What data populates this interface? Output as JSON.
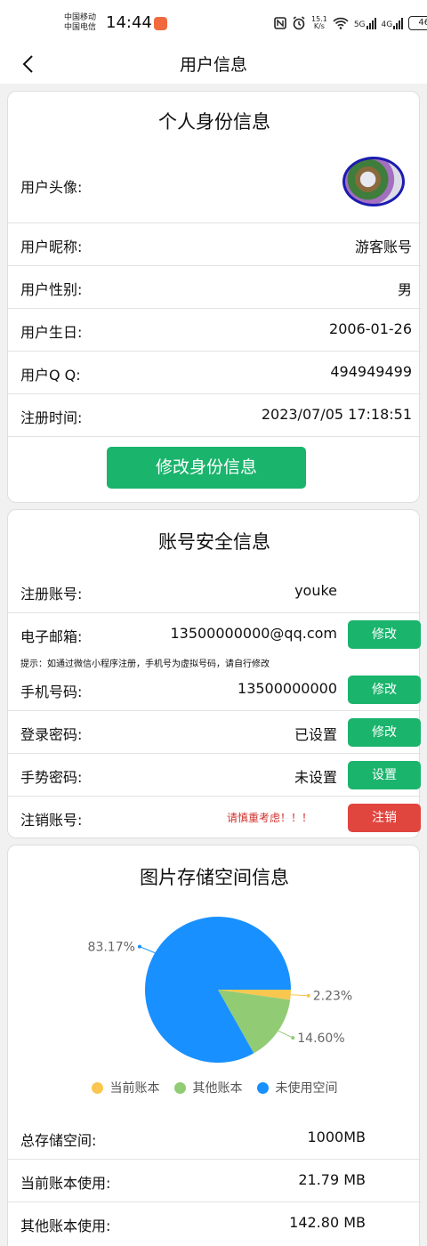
{
  "status_bar": {
    "carrier_1": "中国移动",
    "carrier_2": "中国电信",
    "time": "14:44",
    "net_speed_value": "15.1",
    "net_speed_unit": "K/s",
    "signal_1": "5G",
    "signal_2": "4G",
    "battery": "46"
  },
  "nav": {
    "title": "用户信息"
  },
  "identity": {
    "title": "个人身份信息",
    "avatar_label": "用户头像:",
    "rows": [
      {
        "label": "用户昵称:",
        "value": "游客账号"
      },
      {
        "label": "用户性别:",
        "value": "男"
      },
      {
        "label": "用户生日:",
        "value": "2006-01-26"
      },
      {
        "label": "用户Q Q:",
        "value": "494949499"
      },
      {
        "label": "注册时间:",
        "value": "2023/07/05 17:18:51"
      }
    ],
    "edit_button": "修改身份信息"
  },
  "security": {
    "title": "账号安全信息",
    "account": {
      "label": "注册账号:",
      "value": "youke"
    },
    "email": {
      "label": "电子邮箱:",
      "value": "13500000000@qq.com",
      "button": "修改"
    },
    "hint": "提示：如通过微信小程序注册，手机号为虚拟号码，请自行修改",
    "phone": {
      "label": "手机号码:",
      "value": "13500000000",
      "button": "修改"
    },
    "password": {
      "label": "登录密码:",
      "value": "已设置",
      "button": "修改"
    },
    "gesture": {
      "label": "手势密码:",
      "value": "未设置",
      "button": "设置"
    },
    "cancel": {
      "label": "注销账号:",
      "warning": "请慎重考虑！！！",
      "button": "注销"
    }
  },
  "storage": {
    "title": "图片存储空间信息",
    "rows": [
      {
        "label": "总存储空间:",
        "value": "1000MB"
      },
      {
        "label": "当前账本使用:",
        "value": "21.79 MB"
      },
      {
        "label": "其他账本使用:",
        "value": "142.80 MB"
      }
    ]
  },
  "chart_data": {
    "type": "pie",
    "series": [
      {
        "name": "当前账本",
        "value": 2.23,
        "label": "2.23%",
        "color": "#f9c74f"
      },
      {
        "name": "其他账本",
        "value": 14.6,
        "label": "14.60%",
        "color": "#91cb74"
      },
      {
        "name": "未使用空间",
        "value": 83.17,
        "label": "83.17%",
        "color": "#1890ff"
      }
    ],
    "legend_position": "bottom"
  },
  "colors": {
    "primary_green": "#1bb46d",
    "danger_red": "#e0453e",
    "warning_text": "#d0312d"
  }
}
